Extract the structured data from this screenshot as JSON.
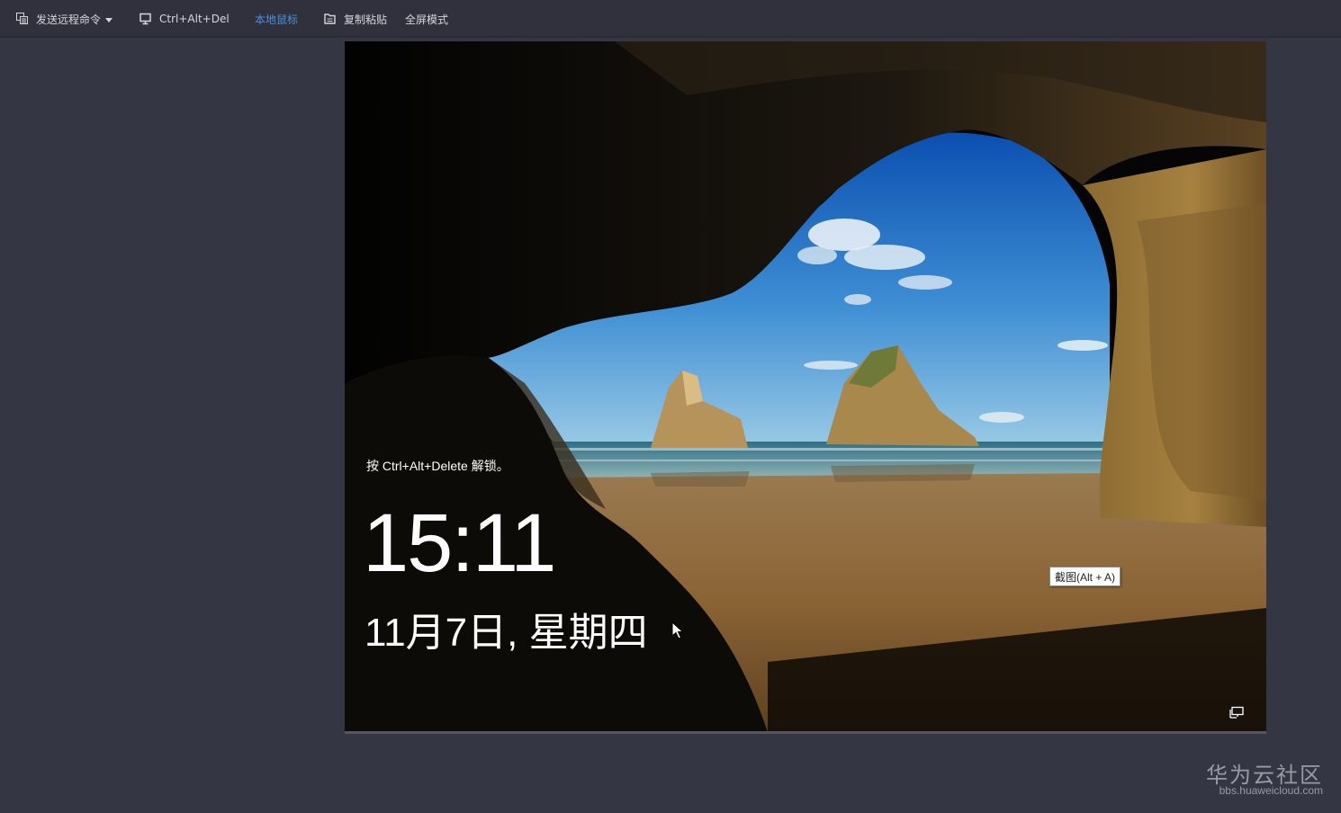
{
  "toolbar": {
    "send_remote_command": "发送远程命令",
    "ctrl_alt_del": "Ctrl+Alt+Del",
    "local_mouse": "本地鼠标",
    "copy_paste": "复制粘贴",
    "fullscreen": "全屏模式"
  },
  "remote_screen": {
    "unlock_hint": "按 Ctrl+Alt+Delete 解锁。",
    "time": "15:11",
    "date": "11月7日, 星期四",
    "tooltip": "截图(Alt + A)"
  },
  "watermark": {
    "title": "华为云社区",
    "url": "bbs.huaweicloud.com"
  },
  "colors": {
    "page_bg": "#353644",
    "toolbar_bg": "#30313d",
    "active_accent": "#4a8fe0",
    "toolbar_text": "#d6d7de"
  },
  "icons": {
    "send_remote_command": "send-command-icon",
    "ctrl_alt_del": "monitor-icon",
    "copy_paste": "clipboard-icon",
    "network": "network-icon",
    "cursor": "mouse-pointer-icon"
  }
}
